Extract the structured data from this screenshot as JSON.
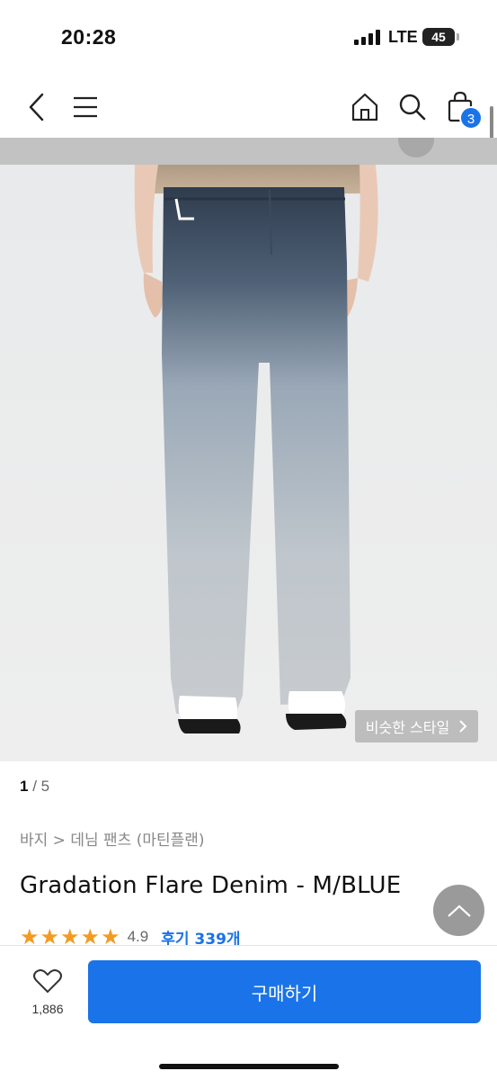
{
  "status_bar": {
    "time": "20:28",
    "network": "LTE",
    "battery": "45"
  },
  "nav": {
    "cart_count": "3",
    "icons": [
      "back-arrow-icon",
      "menu-icon",
      "home-icon",
      "search-icon",
      "shopping-bag-icon"
    ]
  },
  "gallery": {
    "current": "1",
    "total": "/ 5",
    "similar_style": "비슷한 스타일"
  },
  "product": {
    "breadcrumb": "바지 > 데님 팬츠 (마틴플랜)",
    "title": "Gradation Flare Denim - M/BLUE",
    "stars": 5,
    "rating": "4.9",
    "reviews": "후기 339개"
  },
  "actions": {
    "like_count": "1,886",
    "buy_label": "구매하기"
  },
  "colors": {
    "accent": "#1a73e8",
    "star": "#f39a21"
  }
}
